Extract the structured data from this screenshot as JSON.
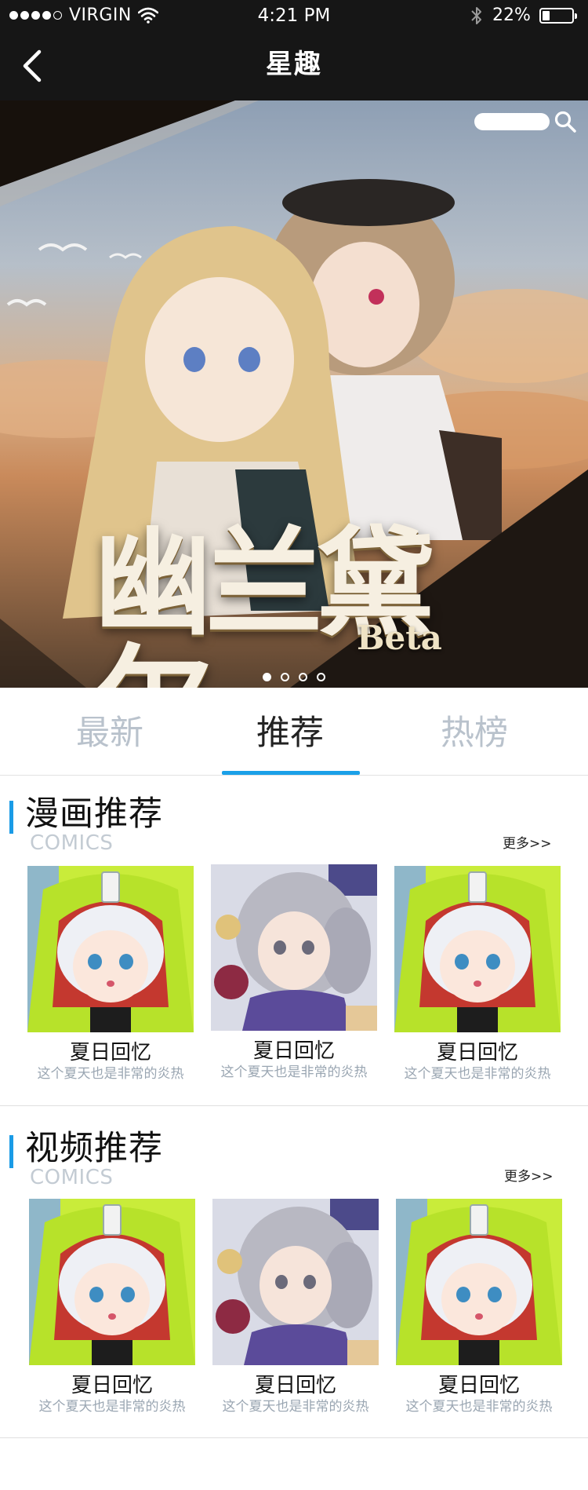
{
  "status_bar": {
    "carrier": "VIRGIN",
    "time": "4:21 PM",
    "battery_percent": "22%",
    "signal_bars": 4,
    "battery_level": 0.22
  },
  "nav": {
    "title": "星趣",
    "back_icon": "chevron-left-icon"
  },
  "banner": {
    "title": "幽兰黛尔",
    "subtitle": "Beta",
    "search_icon": "search-icon",
    "page_count": 4,
    "active_page": 1
  },
  "tabs": [
    {
      "label": "最新",
      "active": false
    },
    {
      "label": "推荐",
      "active": true
    },
    {
      "label": "热榜",
      "active": false
    }
  ],
  "sections": [
    {
      "title": "漫画推荐",
      "subtitle": "COMICS",
      "more": "更多>>",
      "items": [
        {
          "title": "夏日回忆",
          "desc": "这个夏天也是非常的炎热",
          "art": "green-hood"
        },
        {
          "title": "夏日回忆",
          "desc": "这个夏天也是非常的炎热",
          "art": "gray-hair"
        },
        {
          "title": "夏日回忆",
          "desc": "这个夏天也是非常的炎热",
          "art": "green-hood"
        }
      ]
    },
    {
      "title": "视频推荐",
      "subtitle": "COMICS",
      "more": "更多>>",
      "items": [
        {
          "title": "夏日回忆",
          "desc": "这个夏天也是非常的炎热",
          "art": "green-hood"
        },
        {
          "title": "夏日回忆",
          "desc": "这个夏天也是非常的炎热",
          "art": "gray-hair"
        },
        {
          "title": "夏日回忆",
          "desc": "这个夏天也是非常的炎热",
          "art": "green-hood"
        }
      ]
    }
  ],
  "colors": {
    "nav_background": "#161616",
    "accent": "#1aa0e8",
    "tab_inactive": "#b9c2cc",
    "subtitle_gray": "#c3cbd3",
    "desc_gray": "#9aa6b2"
  }
}
